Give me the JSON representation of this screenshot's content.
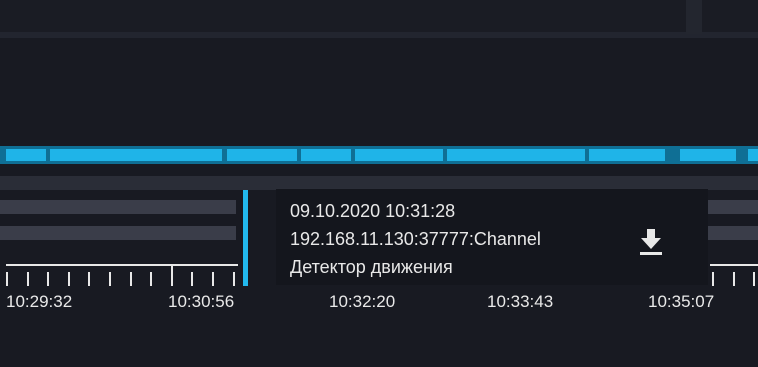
{
  "tooltip": {
    "datetime": "09.10.2020 10:31:28",
    "channel": "192.168.11.130:37777:Channel",
    "event": "Детектор движения",
    "download_icon": "download-icon"
  },
  "timeline": {
    "labels": [
      "10:29:32",
      "10:30:56",
      "10:32:20",
      "10:33:43",
      "10:35:07"
    ],
    "motion_color": "#1fb4e8",
    "cursor_color": "#22b9ee"
  }
}
